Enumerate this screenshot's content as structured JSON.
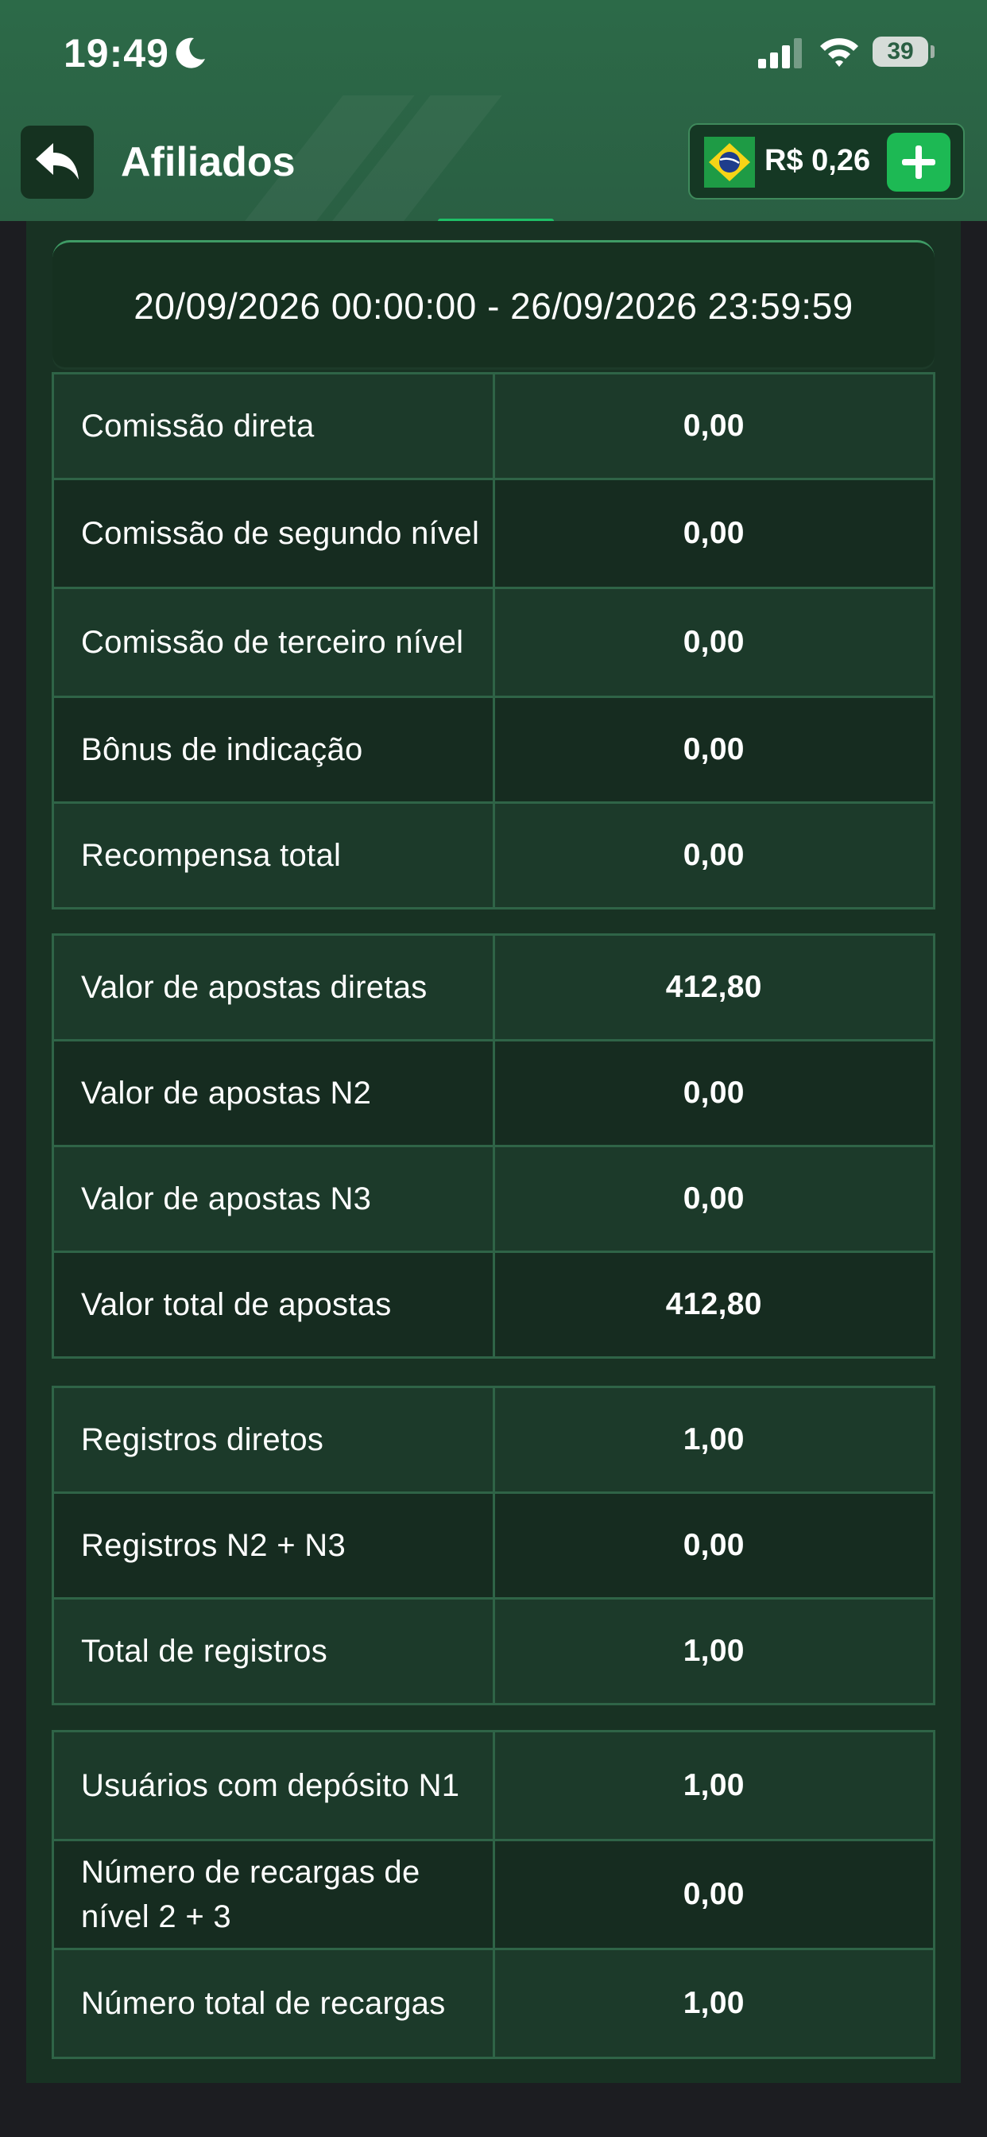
{
  "status_bar": {
    "time": "19:49",
    "battery": "39"
  },
  "header": {
    "title": "Afiliados",
    "balance": "R$ 0,26",
    "colors": {
      "background": "#2a5f43",
      "accent": "#1db954"
    }
  },
  "date_range": "20/09/2026 00:00:00 - 26/09/2026 23:59:59",
  "tables": [
    {
      "rows": [
        {
          "label": "Comissão direta",
          "value": "0,00"
        },
        {
          "label": "Comissão de segundo nível",
          "value": "0,00"
        },
        {
          "label": "Comissão de terceiro nível",
          "value": "0,00"
        },
        {
          "label": "Bônus de indicação",
          "value": "0,00"
        },
        {
          "label": "Recompensa total",
          "value": "0,00"
        }
      ]
    },
    {
      "rows": [
        {
          "label": "Valor de apostas diretas",
          "value": "412,80"
        },
        {
          "label": "Valor de apostas N2",
          "value": "0,00"
        },
        {
          "label": "Valor de apostas N3",
          "value": "0,00"
        },
        {
          "label": "Valor total de apostas",
          "value": "412,80"
        }
      ]
    },
    {
      "rows": [
        {
          "label": "Registros diretos",
          "value": "1,00"
        },
        {
          "label": "Registros N2 + N3",
          "value": "0,00"
        },
        {
          "label": "Total de registros",
          "value": "1,00"
        }
      ]
    },
    {
      "rows": [
        {
          "label": "Usuários com depósito N1",
          "value": "1,00"
        },
        {
          "label": "Número de recargas de nível 2 + 3",
          "value": "0,00"
        },
        {
          "label": "Número total de recargas",
          "value": "1,00"
        }
      ]
    }
  ],
  "icons": {
    "status": [
      "moon-icon",
      "signal-icon",
      "wifi-icon",
      "battery-icon"
    ],
    "header": [
      "back-arrow-icon",
      "brazil-flag-icon",
      "plus-icon"
    ]
  }
}
